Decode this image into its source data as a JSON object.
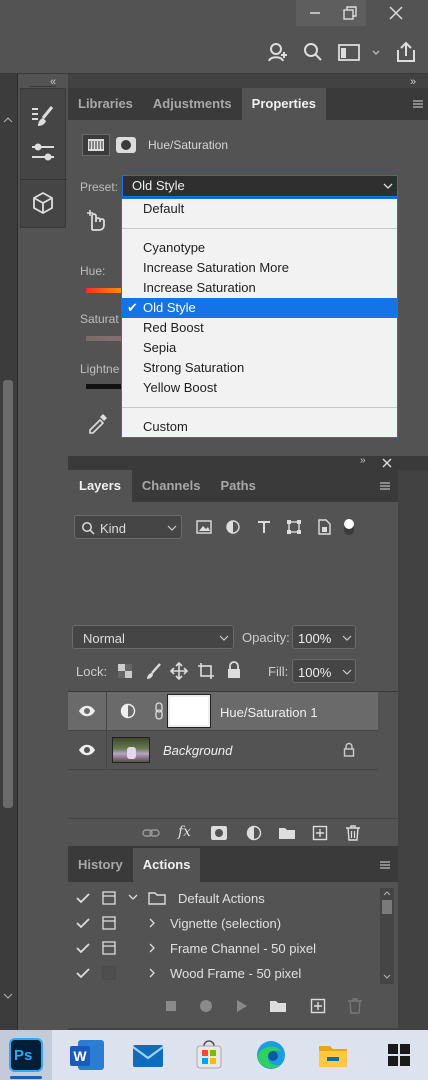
{
  "colors": {
    "accent": "#1473e6",
    "panel": "#535353",
    "dark": "#3a3a3a",
    "taskbar": "#dde3ee"
  },
  "window": {
    "controls": [
      "minimize-icon",
      "restore-icon",
      "close-icon"
    ]
  },
  "toolbar_icons": [
    "share-profile-icon",
    "search-icon",
    "workspace-icon",
    "share-icon"
  ],
  "collapse_left": "«",
  "collapse_right": "»",
  "panels": {
    "props_tabs": [
      {
        "label": "Libraries"
      },
      {
        "label": "Adjustments"
      },
      {
        "label": "Properties"
      }
    ],
    "props_title": "Hue/Saturation",
    "preset_label": "Preset:",
    "preset_value": "Old Style",
    "hue_label": "Hue:",
    "saturation_label": "Saturat",
    "lightness_label": "Lightne",
    "dropdown": {
      "items_a": [
        "Default"
      ],
      "items_b": [
        "Cyanotype",
        "Increase Saturation More",
        "Increase Saturation",
        "Old Style",
        "Red Boost",
        "Sepia",
        "Strong Saturation",
        "Yellow Boost"
      ],
      "items_c": [
        "Custom"
      ],
      "selected": "Old Style"
    },
    "layers_tabs": [
      {
        "label": "Layers"
      },
      {
        "label": "Channels"
      },
      {
        "label": "Paths"
      }
    ],
    "filter_kind": "Kind",
    "blend_mode": "Normal",
    "opacity_label": "Opacity:",
    "opacity_value": "100%",
    "lock_label": "Lock:",
    "fill_label": "Fill:",
    "fill_value": "100%",
    "layers": [
      {
        "name": "Hue/Saturation 1"
      },
      {
        "name": "Background"
      }
    ],
    "history_tabs": [
      {
        "label": "History"
      },
      {
        "label": "Actions"
      }
    ],
    "actions": [
      {
        "label": "Default Actions"
      },
      {
        "label": "Vignette (selection)"
      },
      {
        "label": "Frame Channel - 50 pixel"
      },
      {
        "label": "Wood Frame - 50 pixel"
      }
    ]
  },
  "taskbar": {
    "apps": [
      "photoshop-icon",
      "word-icon",
      "mail-icon",
      "store-icon",
      "edge-icon",
      "file-explorer-icon",
      "start-icon"
    ],
    "ps_text": "Ps",
    "word_text": "W"
  }
}
